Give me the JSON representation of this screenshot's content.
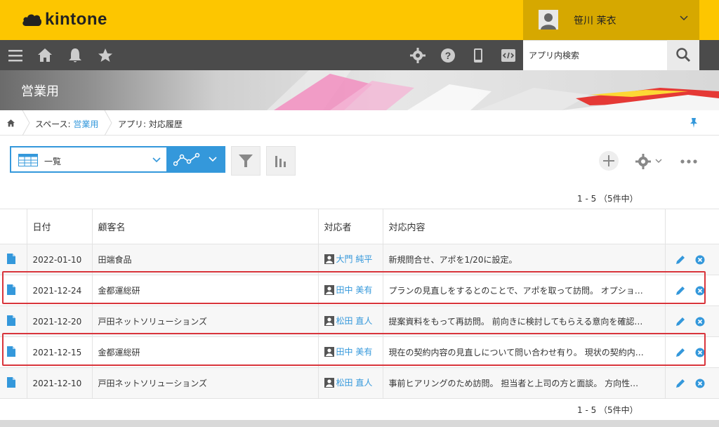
{
  "header": {
    "logo_text": "kintone",
    "user_name": "笹川 茉衣"
  },
  "global_nav": {
    "icons": [
      "menu-icon",
      "home-icon",
      "bell-icon",
      "star-icon",
      "gear-icon",
      "help-icon",
      "mobile-icon",
      "code-icon"
    ],
    "search_placeholder": "アプリ内検索"
  },
  "space": {
    "title": "営業用"
  },
  "breadcrumb": {
    "space_prefix": "スペース: ",
    "space_name": "営業用",
    "app_label": "アプリ: 対応履歴"
  },
  "toolbar": {
    "view_name": "一覧",
    "pager_top": "1 - 5 （5件中）",
    "pager_bottom": "1 - 5 （5件中）"
  },
  "table": {
    "columns": [
      "日付",
      "顧客名",
      "対応者",
      "対応内容"
    ],
    "rows": [
      {
        "date": "2022-01-10",
        "customer": "田端食品",
        "assignee": "大門 純平",
        "content": "新規問合せ、アポを1/20に設定。"
      },
      {
        "date": "2021-12-24",
        "customer": "金都運総研",
        "assignee": "田中 美有",
        "content": "プランの見直しをするとのことで、アポを取って訪問。 オプショ…"
      },
      {
        "date": "2021-12-20",
        "customer": "戸田ネットソリューションズ",
        "assignee": "松田 直人",
        "content": "提案資料をもって再訪問。 前向きに検討してもらえる意向を確認…"
      },
      {
        "date": "2021-12-15",
        "customer": "金都運総研",
        "assignee": "田中 美有",
        "content": "現在の契約内容の見直しについて問い合わせ有り。 現状の契約内…"
      },
      {
        "date": "2021-12-10",
        "customer": "戸田ネットソリューションズ",
        "assignee": "松田 直人",
        "content": "事前ヒアリングのため訪問。 担当者と上司の方と面談。 方向性…"
      }
    ]
  },
  "colors": {
    "brand_yellow": "#fdc600",
    "nav_gray": "#4b4b4b",
    "accent_blue": "#3498db",
    "highlight_red": "#d9353c"
  }
}
